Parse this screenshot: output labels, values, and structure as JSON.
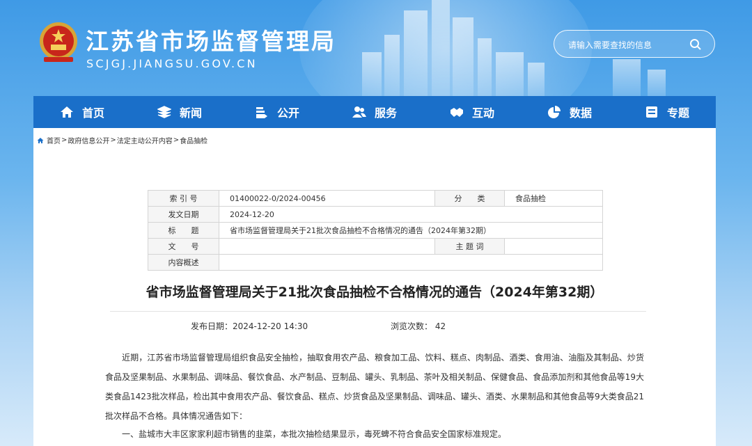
{
  "header": {
    "title": "江苏省市场监督管理局",
    "domain": "SCJGJ.JIANGSU.GOV.CN",
    "emblem_icon": "national-emblem-icon"
  },
  "search": {
    "placeholder": "请输入需要查找的信息",
    "icon": "search-icon"
  },
  "nav": {
    "items": [
      {
        "label": "首页",
        "icon": "home-icon"
      },
      {
        "label": "新闻",
        "icon": "layers-icon"
      },
      {
        "label": "公开",
        "icon": "open-hand-icon"
      },
      {
        "label": "服务",
        "icon": "people-icon"
      },
      {
        "label": "互动",
        "icon": "handshake-icon"
      },
      {
        "label": "数据",
        "icon": "pie-chart-icon"
      },
      {
        "label": "专题",
        "icon": "panel-icon"
      }
    ]
  },
  "breadcrumb": {
    "items": [
      "首页",
      "政府信息公开",
      "法定主动公开内容",
      "食品抽检"
    ],
    "separator": ">"
  },
  "meta": {
    "index_label": "索 引 号",
    "index_value": "01400022-0/2024-00456",
    "category_label": "分　　类",
    "category_value": "食品抽检",
    "date_label": "发文日期",
    "date_value": "2024-12-20",
    "title_label": "标　　题",
    "title_value": "省市场监督管理局关于21批次食品抽检不合格情况的通告（2024年第32期）",
    "docno_label": "文　　号",
    "docno_value": "",
    "keywords_label": "主 题 词",
    "keywords_value": "",
    "summary_label": "内容概述",
    "summary_value": ""
  },
  "article": {
    "title": "省市场监督管理局关于21批次食品抽检不合格情况的通告（2024年第32期）",
    "publish_label": "发布日期：",
    "publish_time": "2024-12-20 14:30",
    "views_label": "浏览次数：",
    "views_count": "42",
    "paragraph1": "近期，江苏省市场监督管理局组织食品安全抽检，抽取食用农产品、粮食加工品、饮料、糕点、肉制品、酒类、食用油、油脂及其制品、炒货食品及坚果制品、水果制品、调味品、餐饮食品、水产制品、豆制品、罐头、乳制品、茶叶及相关制品、保健食品、食品添加剂和其他食品等19大类食品1423批次样品，检出其中食用农产品、餐饮食品、糕点、炒货食品及坚果制品、调味品、罐头、酒类、水果制品和其他食品等9大类食品21批次样品不合格。具体情况通告如下：",
    "item1": "一、盐城市大丰区家家利超市销售的韭菜，本批次抽检结果显示，毒死蜱不符合食品安全国家标准规定。"
  },
  "colors": {
    "nav_bg": "#1a6fc9",
    "header_gradient_top": "#3f9ae6",
    "text": "#333333"
  }
}
